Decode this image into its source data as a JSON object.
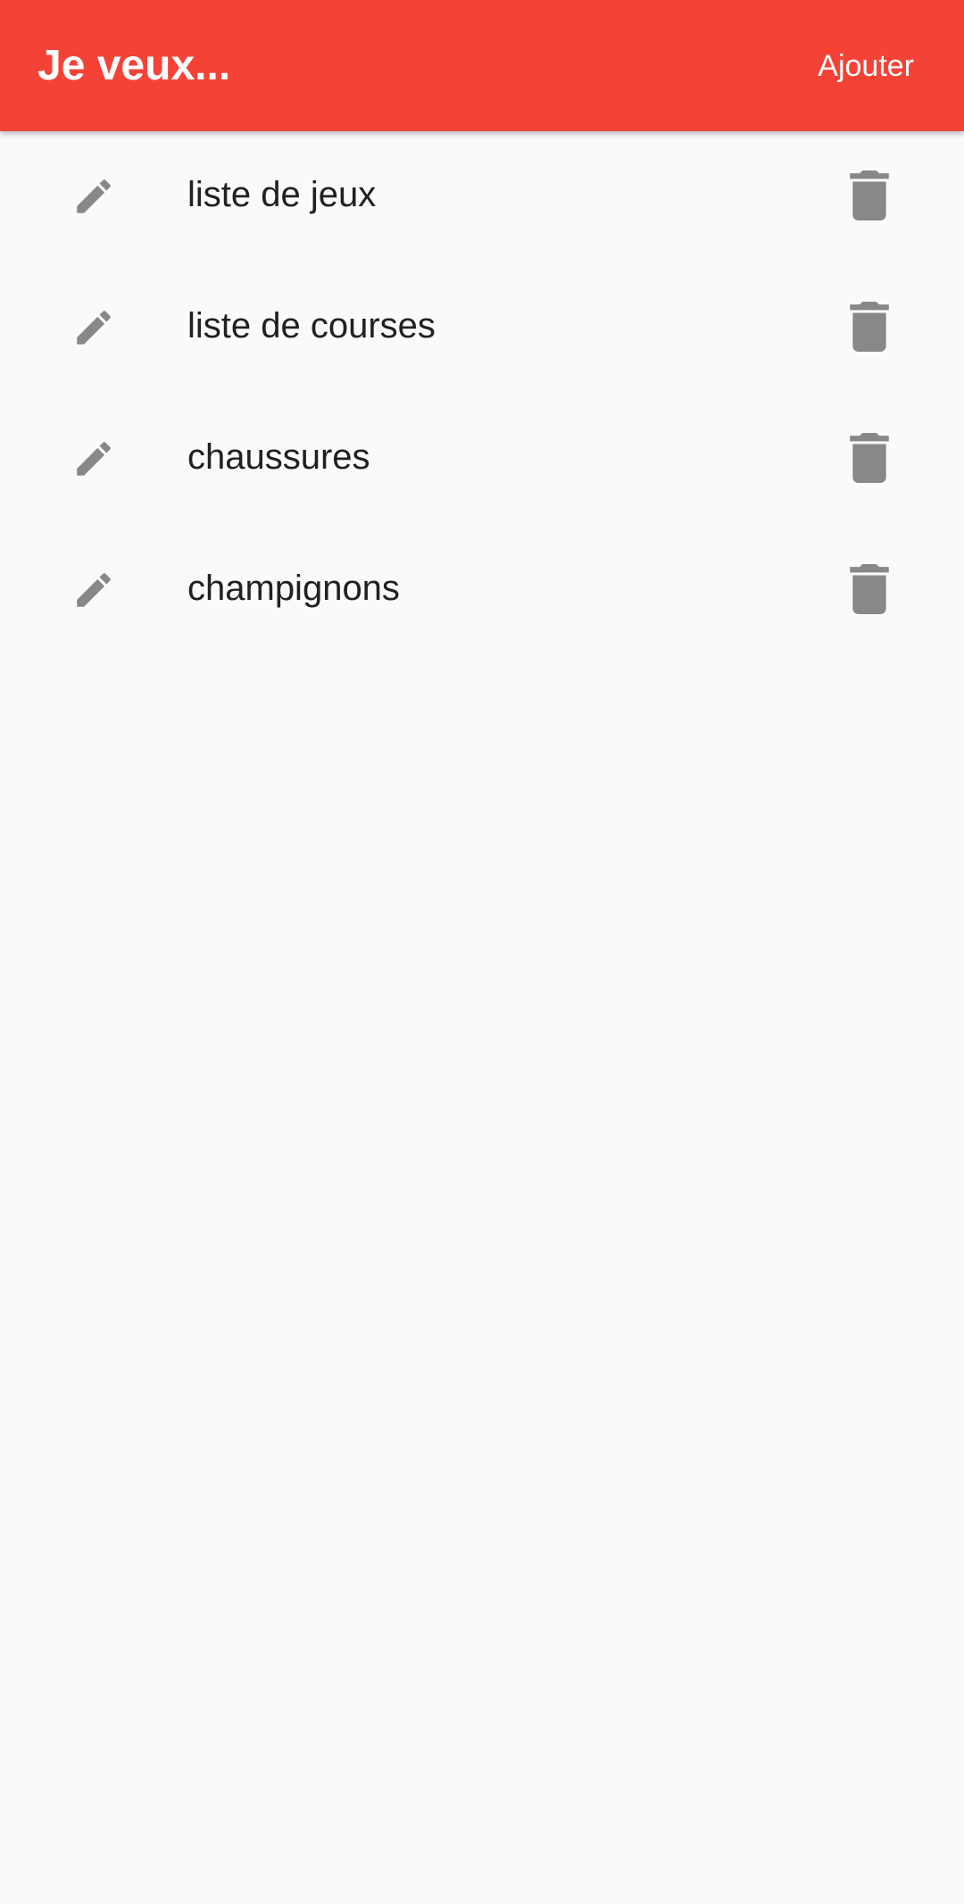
{
  "app_bar": {
    "title": "Je veux...",
    "add_label": "Ajouter",
    "color": "#f44336"
  },
  "list": {
    "icon_color": "#888888",
    "items": [
      {
        "label": "liste de jeux",
        "edit_icon": "pencil-icon",
        "delete_icon": "trash-icon"
      },
      {
        "label": "liste de courses",
        "edit_icon": "pencil-icon",
        "delete_icon": "trash-icon"
      },
      {
        "label": "chaussures",
        "edit_icon": "pencil-icon",
        "delete_icon": "trash-icon"
      },
      {
        "label": "champignons",
        "edit_icon": "pencil-icon",
        "delete_icon": "trash-icon"
      }
    ]
  }
}
